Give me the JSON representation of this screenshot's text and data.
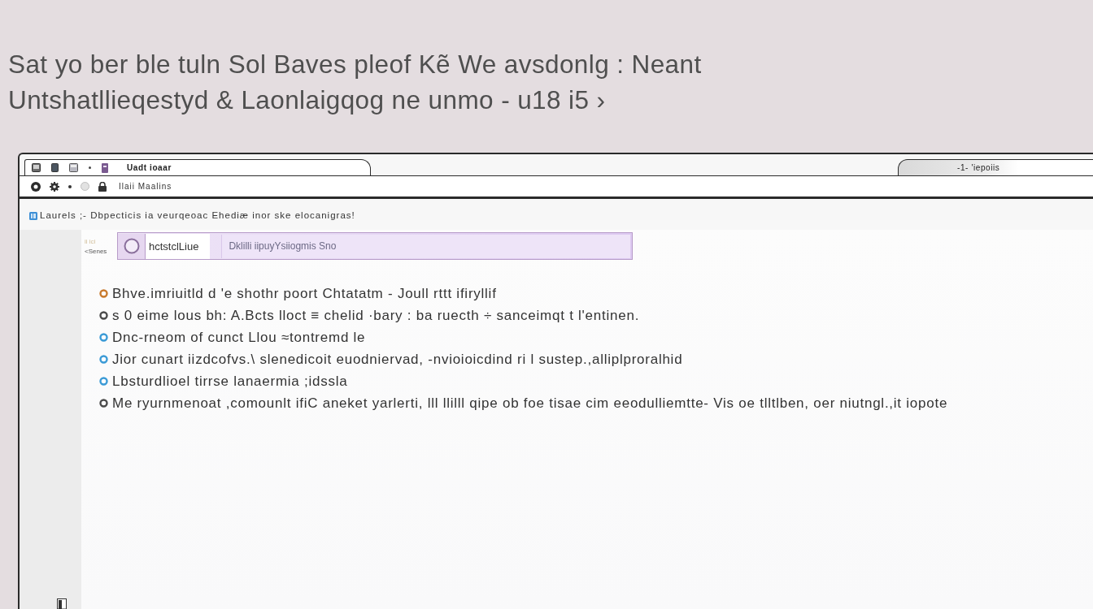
{
  "heading": {
    "lines": [
      "Sat yo ber ble tuln Sol Baves pleof Kẽ We avsdonlg : Neant",
      "Untshatllieqestyd & Laonlaigqog ne unmo - u18  i5 ›"
    ]
  },
  "browser": {
    "tabs": [
      {
        "label": "Uadt  ioaar",
        "selected": true
      },
      {
        "label": "-1-  'iepoiis",
        "selected": false
      }
    ],
    "address": {
      "value": "Ilaii  Maalins"
    },
    "bookmarks": {
      "text": "Laurels ;- Dbpecticis  ia veurqeoac Ehediæ  inor ske elocanigras!"
    }
  },
  "page": {
    "search": {
      "caption": "ii ici",
      "label": "<Senes",
      "scope": "hctstclLiue",
      "placeholder": "Dklilli iipuyYsiiogmis Sno"
    },
    "items": [
      {
        "text": "Bhve.imriuitld d 'e shothr poort  Chtatatm  - Joull rttt ifiryllif",
        "color": "#c8792c"
      },
      {
        "text": "s 0 eime lous bh: A.Bcts lloct ≡  chelid ·bary : ba ruecth ÷ sanceimqt  t l'entinen.",
        "color": "#4a4a4a"
      },
      {
        "text": "Dnc-rneom of cunct Llou ≈tontremd le",
        "color": "#3a9ad6"
      },
      {
        "text": "Jior cunart iizdcofvs.\\ slenedicoit euodniervad, -nvioioicdind ri l sustep.,alliplproralhid",
        "color": "#3a9ad6"
      },
      {
        "text": "Lbsturdlioel tirrse lanaermia ;idssla",
        "color": "#3a9ad6"
      },
      {
        "text": "Me ryurnmenoat ,comounlt ifiC aneket yarlerti, lll llilll qipe ob foe tisae cim eeodulliemtte- Vis oe tlltlben, oer niutngl.,it iopote",
        "color": "#4a4a4a"
      }
    ]
  }
}
